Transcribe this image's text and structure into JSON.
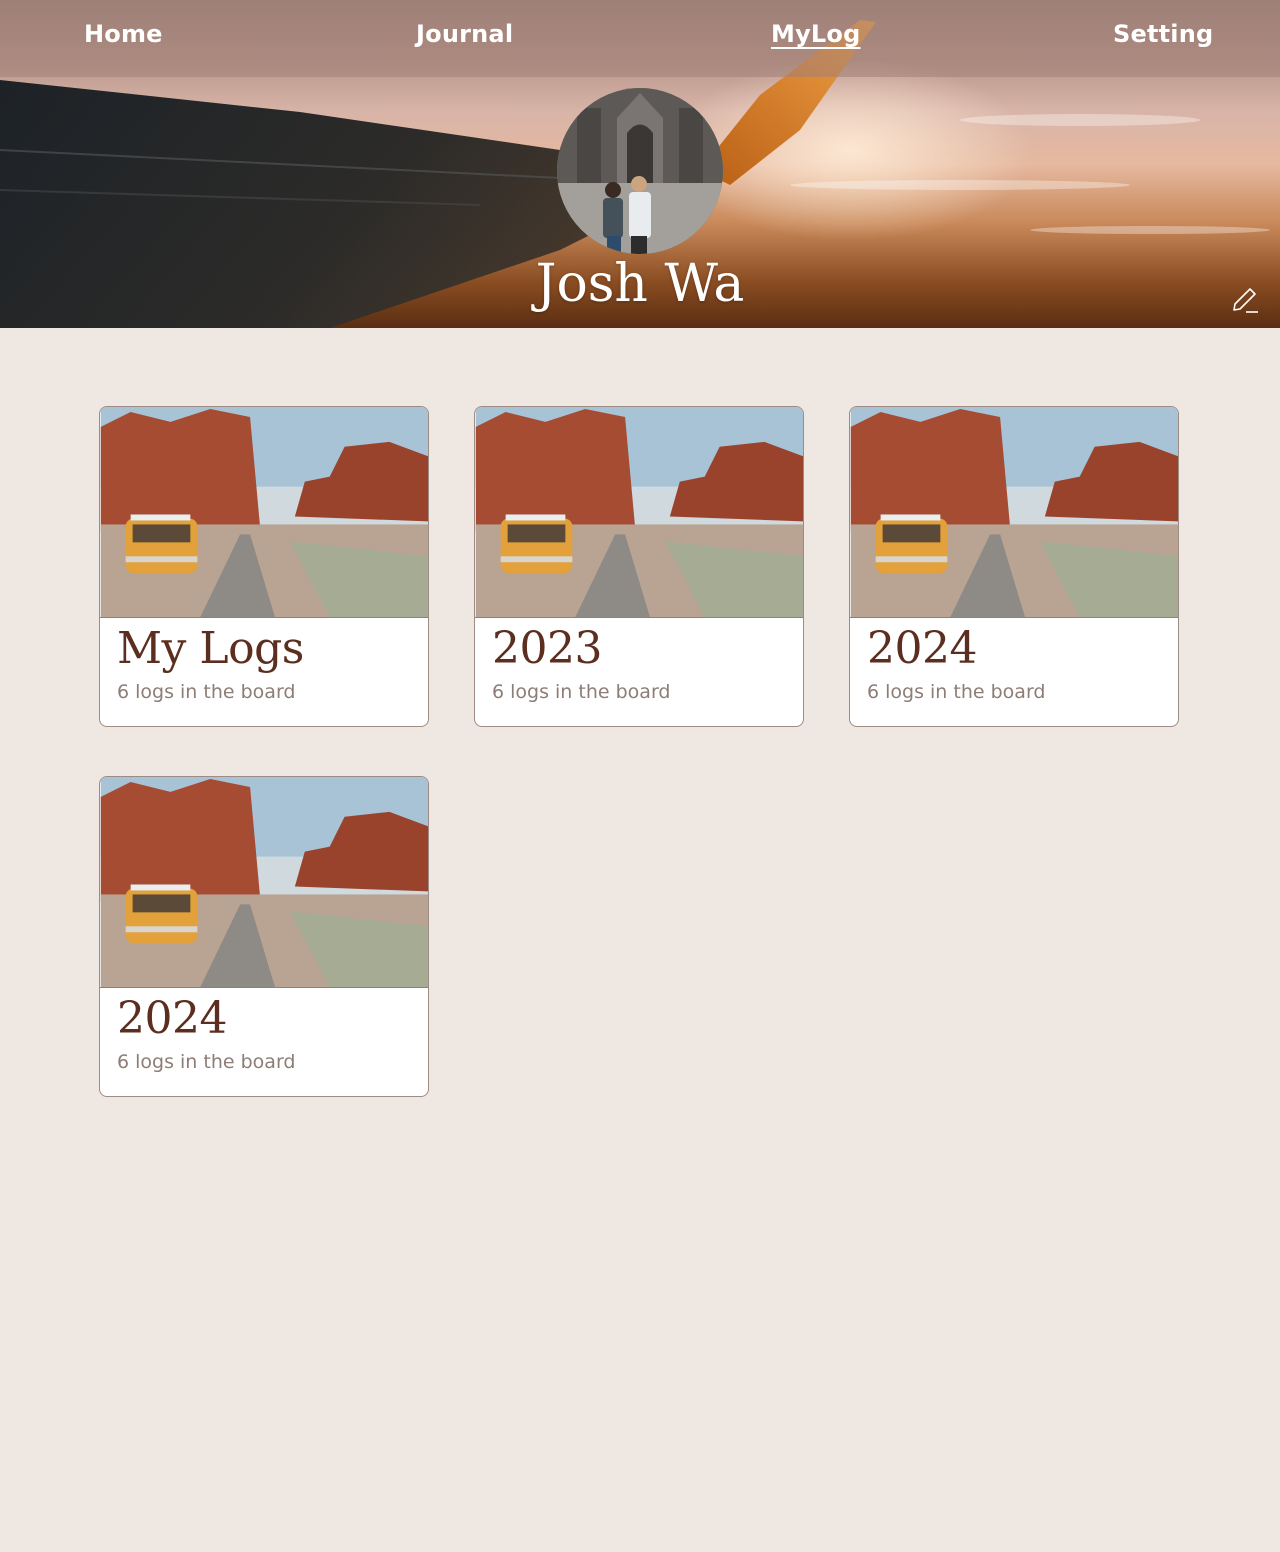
{
  "nav": {
    "items": [
      {
        "label": "Home",
        "active": false
      },
      {
        "label": "Journal",
        "active": false
      },
      {
        "label": "MyLog",
        "active": true
      },
      {
        "label": "Setting",
        "active": false
      }
    ]
  },
  "profile": {
    "name": "Josh Wa",
    "edit_icon": "pencil-icon"
  },
  "boards": [
    {
      "title": "My Logs",
      "subtitle": "6 logs in the board"
    },
    {
      "title": "2023",
      "subtitle": "6 logs in the board"
    },
    {
      "title": "2024",
      "subtitle": "6 logs in the board"
    },
    {
      "title": "2024",
      "subtitle": "6 logs in the board"
    }
  ]
}
